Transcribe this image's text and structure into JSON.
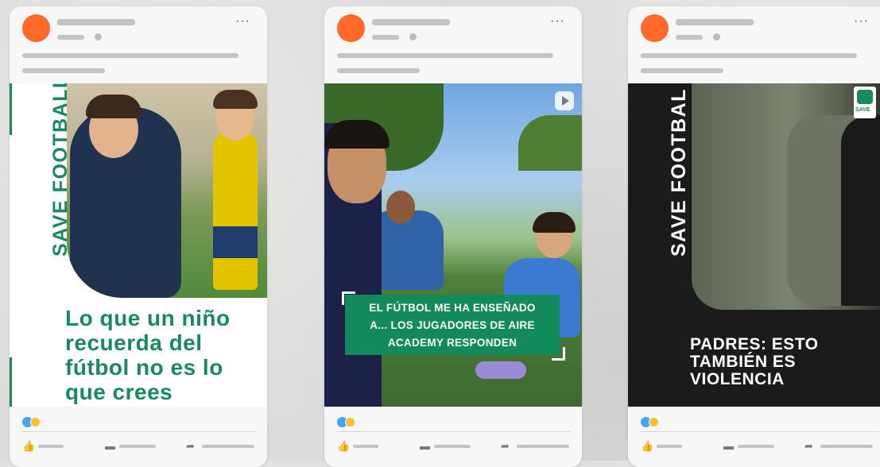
{
  "posts": [
    {
      "media": {
        "vertical_brand": "SAVE FOOTBALL",
        "headline_lines": [
          "Lo que un niño",
          "recuerda del",
          "fútbol no es lo",
          "que crees"
        ]
      }
    },
    {
      "media": {
        "caption_lines": [
          "EL FÚTBOL ME HA ENSEÑADO",
          "A... LOS JUGADORES DE AIRE",
          "ACADEMY RESPONDEN"
        ]
      }
    },
    {
      "media": {
        "vertical_brand": "SAVE FOOTBAL",
        "headline_lines": [
          "PADRES: ESTO",
          "TAMBIÉN ES",
          "VIOLENCIA"
        ]
      }
    }
  ],
  "ui": {
    "more_glyph": "···",
    "like_glyph": "👍",
    "comment_glyph": "▬",
    "share_glyph": "➦"
  },
  "colors": {
    "avatar": "#ff6a2b",
    "brand_green": "#1a8a5a",
    "caption_green": "#138a5c"
  }
}
